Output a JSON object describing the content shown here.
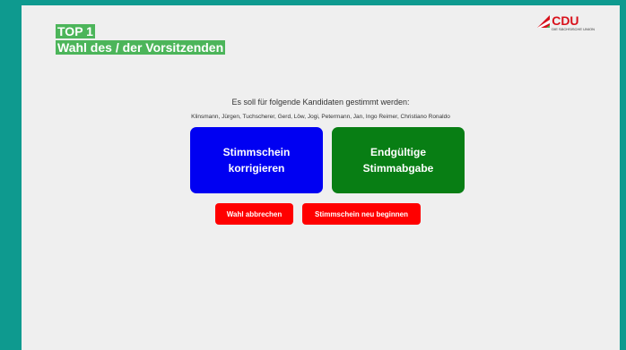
{
  "header": {
    "title_line1": "TOP 1",
    "title_line2": "Wahl des / der Vorsitzenden"
  },
  "logo": {
    "name": "CDU",
    "subtitle": "DIE SÄCHSISCHE UNION",
    "icon": "cdu-flag-icon",
    "color": "#d8101a"
  },
  "ballot": {
    "prompt": "Es soll für folgende Kandidaten gestimmt werden:",
    "candidates": "Klinsmann, Jürgen, Tuchscherer, Gerd, Löw, Jogi, Petermann, Jan, Ingo Reimer, Christiano Ronaldo"
  },
  "buttons": {
    "correct_label": "Stimmschein\nkorrigieren",
    "final_label": "Endgültige\nStimmabgabe",
    "cancel_label": "Wahl abbrechen",
    "restart_label": "Stimmschein neu beginnen"
  },
  "colors": {
    "frame": "#0e9a8f",
    "title_highlight": "#4cb55a",
    "correct": "#0000f2",
    "final": "#087e14",
    "danger": "#ff0000"
  }
}
